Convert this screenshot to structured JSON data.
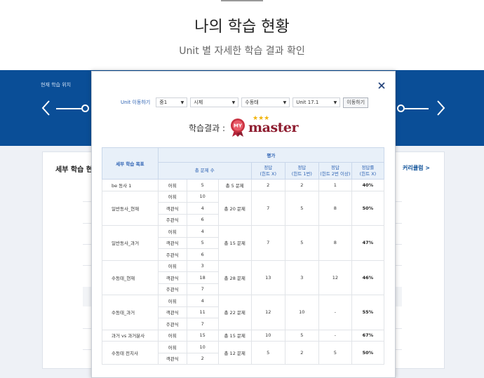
{
  "header": {
    "title": "나의 학습 현황",
    "subtitle": "Unit 별 자세한 학습 결과 확인"
  },
  "background": {
    "band_label": "현재 학습 위치",
    "card_title": "세부 학습 현황",
    "card_link": "커리큘럼 >",
    "band_color": "#0a4e97"
  },
  "modal": {
    "close_icon": "close-icon",
    "nav_label": "Unit 이동하기",
    "selects": [
      "중1",
      "시제",
      "수동태",
      "Unit 17.1"
    ],
    "move_button": "이동하기",
    "result_label": "학습결과 :",
    "badge_text": "MY",
    "stars": "★★★",
    "level": "master",
    "table": {
      "head_goal": "세부 학습 목표",
      "head_eval": "평가",
      "head_total": "총 문제 수",
      "head_cols": [
        [
          "정답",
          "(힌트 X)"
        ],
        [
          "정답",
          "(힌트 1번)"
        ],
        [
          "정답",
          "(힌트 2번 이상)"
        ],
        [
          "정답률",
          "(힌트 X)"
        ]
      ],
      "groups": [
        {
          "goal": "be 동사 1",
          "rows": [
            [
              "어휘",
              "5"
            ]
          ],
          "total": "총 5 문제",
          "c1": "2",
          "c2": "2",
          "c3": "1",
          "rate": "40%"
        },
        {
          "goal": "일반동사_현재",
          "rows": [
            [
              "어휘",
              "10"
            ],
            [
              "객관식",
              "4"
            ],
            [
              "주관식",
              "6"
            ]
          ],
          "total": "총 20 문제",
          "c1": "7",
          "c2": "5",
          "c3": "8",
          "rate": "50%"
        },
        {
          "goal": "일반동사_과거",
          "rows": [
            [
              "어휘",
              "4"
            ],
            [
              "객관식",
              "5"
            ],
            [
              "주관식",
              "6"
            ]
          ],
          "total": "총 15 문제",
          "c1": "7",
          "c2": "5",
          "c3": "8",
          "rate": "47%"
        },
        {
          "goal": "수동태_현재",
          "rows": [
            [
              "어휘",
              "3"
            ],
            [
              "객관식",
              "18"
            ],
            [
              "주관식",
              "7"
            ]
          ],
          "total": "총 28 문제",
          "c1": "13",
          "c2": "3",
          "c3": "12",
          "rate": "46%"
        },
        {
          "goal": "수동태_과거",
          "rows": [
            [
              "어휘",
              "4"
            ],
            [
              "객관식",
              "11"
            ],
            [
              "주관식",
              "7"
            ]
          ],
          "total": "총 22 문제",
          "c1": "12",
          "c2": "10",
          "c3": "-",
          "rate": "55%"
        },
        {
          "goal": "과거 vs 과거분사",
          "rows": [
            [
              "어휘",
              "15"
            ]
          ],
          "total": "총 15 문제",
          "c1": "10",
          "c2": "5",
          "c3": "-",
          "rate": "67%"
        },
        {
          "goal": "수동태 전치사",
          "rows": [
            [
              "어휘",
              "10"
            ],
            [
              "객관식",
              "2"
            ]
          ],
          "total": "총 12 문제",
          "c1": "5",
          "c2": "2",
          "c3": "5",
          "rate": "50%"
        }
      ]
    }
  }
}
